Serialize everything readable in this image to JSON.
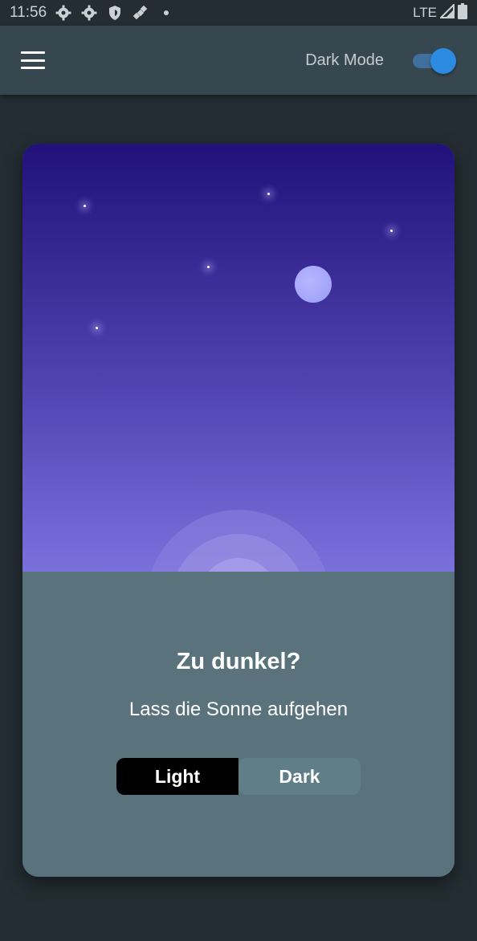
{
  "status": {
    "time": "11:56",
    "network": "LTE",
    "icons": [
      "gear-icon",
      "gear-icon",
      "shield-icon",
      "satellite-icon",
      "dot-icon"
    ]
  },
  "appbar": {
    "menu_icon": "hamburger-menu-icon",
    "dark_mode_label": "Dark Mode",
    "dark_mode_on": true,
    "accent": "#2c8be0"
  },
  "card": {
    "title": "Zu dunkel?",
    "subtitle": "Lass die Sonne aufgehen",
    "segments": [
      {
        "label": "Light",
        "selected": false
      },
      {
        "label": "Dark",
        "selected": true
      }
    ]
  },
  "colors": {
    "background": "#232d33",
    "appbar": "#37474f",
    "card_bottom": "#59727c",
    "sky_top": "#22117a",
    "sky_bottom": "#7a70dc"
  }
}
